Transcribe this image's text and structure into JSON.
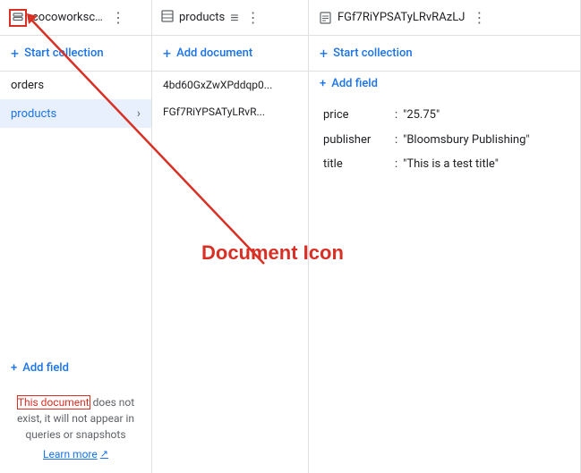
{
  "tabs": [
    {
      "id": "tab1",
      "label": "cocoworksco...",
      "icon": "database-icon",
      "hasMore": true
    },
    {
      "id": "tab2",
      "label": "products",
      "icon": "collection-icon",
      "hasFilter": true,
      "hasMore": true
    },
    {
      "id": "tab3",
      "label": "FGf7RiYPSATyLRvRAzLJ",
      "icon": "document-icon",
      "hasMore": true
    }
  ],
  "panel1": {
    "action_label": "Start collection",
    "items": [
      {
        "label": "orders",
        "selected": false
      },
      {
        "label": "products",
        "selected": true
      }
    ],
    "add_field_label": "Add field"
  },
  "panel2": {
    "action_label": "Add document",
    "docs": [
      {
        "label": "4bd60GxZwXPddqp0..."
      },
      {
        "label": "FGf7RiYPSATyLRvR..."
      }
    ]
  },
  "panel3": {
    "start_collection_label": "Start collection",
    "add_field_label": "Add field",
    "fields": [
      {
        "key": "price",
        "sep": ":",
        "value": "\"25.75\""
      },
      {
        "key": "publisher",
        "sep": ":",
        "value": "\"Bloomsbury Publishing\""
      },
      {
        "key": "title",
        "sep": ":",
        "value": "\"This is a test title\""
      }
    ]
  },
  "annotation": {
    "title": "Document Icon",
    "notice": "This document does not exist, it will not appear in queries or snapshots",
    "notice_linked": "This document",
    "learn_more": "Learn more",
    "learn_more_icon": "external-link-icon"
  },
  "colors": {
    "accent": "#1a73e8",
    "danger": "#d93025",
    "annotation": "#d93025"
  }
}
